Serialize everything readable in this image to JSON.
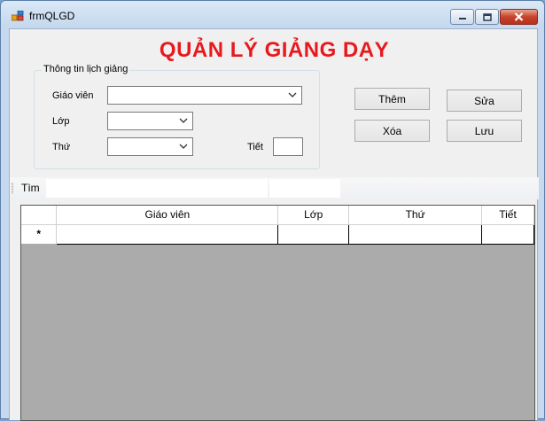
{
  "window": {
    "title": "frmQLGD"
  },
  "form": {
    "heading": "QUẢN LÝ GIẢNG DẠY"
  },
  "group": {
    "legend": "Thông tin lịch giảng",
    "teacher_label": "Giáo viên",
    "teacher_value": "",
    "class_label": "Lớp",
    "class_value": "",
    "day_label": "Thứ",
    "day_value": "",
    "period_label": "Tiết",
    "period_value": ""
  },
  "buttons": {
    "add": "Thêm",
    "edit": "Sửa",
    "delete": "Xóa",
    "save": "Lưu"
  },
  "search": {
    "label": "Tìm",
    "value": ""
  },
  "grid": {
    "columns": [
      "Giáo viên",
      "Lớp",
      "Thứ",
      "Tiết"
    ],
    "new_row_marker": "*"
  }
}
